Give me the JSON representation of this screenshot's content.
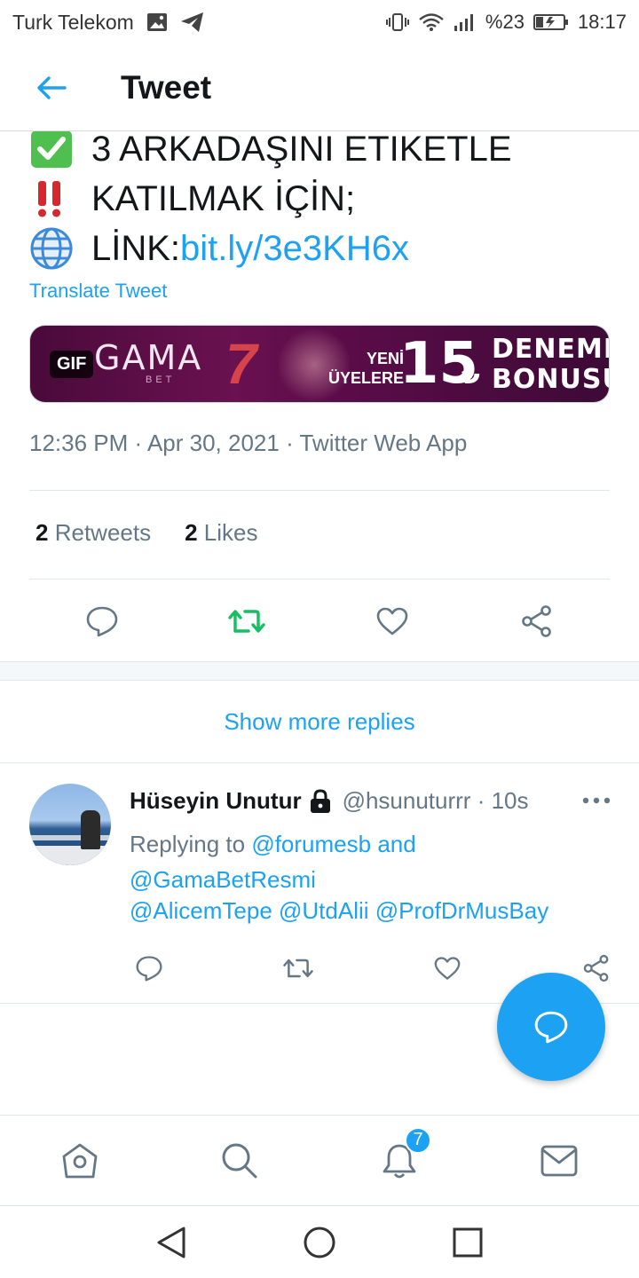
{
  "status_bar": {
    "carrier": "Turk Telekom",
    "battery": "%23",
    "time": "18:17",
    "icons": [
      "gallery-icon",
      "telegram-icon",
      "vibrate-icon",
      "wifi-icon",
      "signal-icon",
      "battery-charging-icon"
    ]
  },
  "header": {
    "title": "Tweet",
    "back_icon": "back-arrow-icon"
  },
  "tweet": {
    "line1": "3 ARKADAŞINI ETIKETLE",
    "line2": "KATILMAK İÇİN;",
    "line3_prefix": "LİNK: ",
    "line3_link": "bit.ly/3e3KH6x",
    "emojis": [
      "check-mark-emoji",
      "double-exclamation-emoji",
      "globe-emoji"
    ],
    "translate": "Translate Tweet",
    "media": {
      "badge": "GIF",
      "logo": "GAMA",
      "logo_sub": "BET",
      "promo_small_1": "YENİ",
      "promo_small_2": "ÜYELERE",
      "promo_amount": "15",
      "promo_currency": "₺",
      "promo_right_1": "DENEME",
      "promo_right_2": "BONUSU"
    },
    "meta": "12:36 PM · Apr 30, 2021 · Twitter Web App",
    "retweets_count": "2",
    "retweets_label": "Retweets",
    "likes_count": "2",
    "likes_label": "Likes",
    "colors": {
      "link": "#1da1f2",
      "retweet_active": "#17bf63",
      "muted": "#657786"
    }
  },
  "show_more": "Show more replies",
  "reply": {
    "name": "Hüseyin Unutur",
    "handle_time": "@hsunuturrr · 10s",
    "replying_prefix": "Replying to ",
    "replying_1": "@forumesb",
    "replying_and": " and",
    "replying_2": "@GamaBetResmi",
    "mentions": "@AlicemTepe @UtdAlii @ProfDrMusBay"
  },
  "bottom_nav": {
    "items": [
      "home-icon",
      "search-icon",
      "notifications-icon",
      "messages-icon"
    ],
    "notification_badge": "7"
  },
  "system_nav": [
    "back-triangle-icon",
    "home-circle-icon",
    "recents-square-icon"
  ]
}
